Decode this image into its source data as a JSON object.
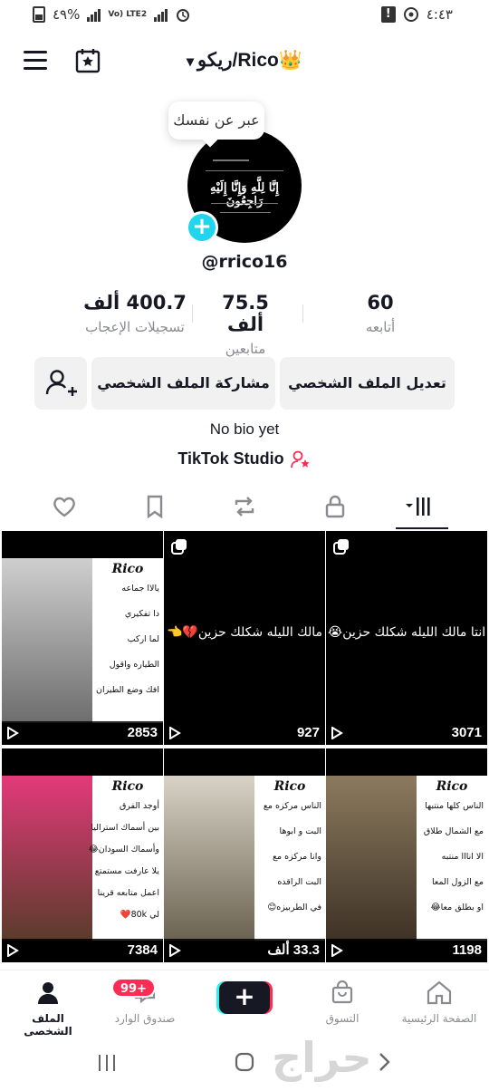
{
  "status_bar": {
    "battery_percent": "٤٩%",
    "network": "Vo) LTE2",
    "time": "٤:٤٣"
  },
  "header": {
    "username": "ريكو/Rico👑",
    "icons": [
      "menu-icon",
      "calendar-star-icon",
      "chevron-down-icon"
    ]
  },
  "profile": {
    "bio_prompt": "عبر عن نفسك",
    "avatar_text": "إِنَّا لِلَّهِ وَإِنَّا إِلَيْهِ رَاجِعُونَ",
    "handle": "@rrico16",
    "bio": "No bio yet",
    "studio_label": "TikTok Studio"
  },
  "stats": [
    {
      "value": "60",
      "label": "أتابعه"
    },
    {
      "value": "75.5 ألف",
      "label": "متابعين"
    },
    {
      "value": "400.7 ألف",
      "label": "تسجيلات الإعجاب"
    }
  ],
  "actions": {
    "edit_profile": "تعديل الملف الشخصي",
    "share_profile": "مشاركة الملف الشخصي"
  },
  "tabs": [
    "videos-grid-icon",
    "lock-icon",
    "repost-icon",
    "bookmark-icon",
    "heart-icon"
  ],
  "videos": [
    {
      "views": "2853",
      "card_title": "Rico",
      "card_lines": [
        "يالاا جماعه",
        "دا تفكيري",
        "لما اركب",
        "الطياره واقول",
        "افك وضع الطيران"
      ]
    },
    {
      "views": "927",
      "caption": "مالك الليله شكلك حزين💔👈"
    },
    {
      "views": "3071",
      "caption": "انتا مالك الليله شكلك حزين😭"
    },
    {
      "views": "7384",
      "card_title": "Rico",
      "card_lines": [
        "أوجد الفرق",
        "بين أسماك استراليا",
        "وأسماك السودان😂",
        "يلا عارفت مستمتع",
        "اعمل متابعه قرينا",
        "لي 80k❤️"
      ]
    },
    {
      "views": "33.3 ألف",
      "card_title": "Rico",
      "card_lines": [
        "الناس مركزه مع",
        "البت و ابوها",
        "وانا مركزه مع",
        "البت الراقده",
        "في الطربيزه😊"
      ]
    },
    {
      "views": "1198",
      "card_title": "Rico",
      "card_lines": [
        "الناس كلها منتبها",
        "مع الشمال طلاق",
        "الا انااا منتبه",
        "مع الزول المعا",
        "او بطلق معا😂"
      ]
    }
  ],
  "bottom_nav": {
    "home": "الصفحة الرئيسية",
    "shop": "التسوق",
    "inbox": "صندوق الوارد",
    "inbox_badge": "99+",
    "profile": "الملف الشخصي"
  },
  "watermark": "حراج",
  "colors": {
    "accent_cyan": "#20d5ec",
    "accent_red": "#fe2c55",
    "text": "#161823",
    "muted": "#8a8b91"
  }
}
